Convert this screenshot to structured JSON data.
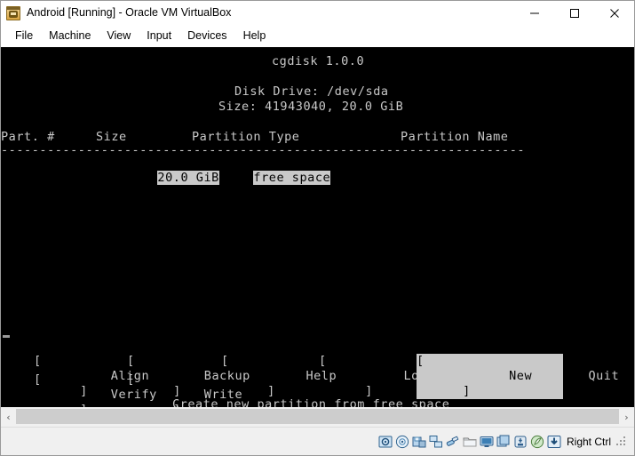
{
  "window": {
    "title": "Android [Running] - Oracle VM VirtualBox",
    "app_icon": "virtualbox-vm-icon",
    "controls": {
      "minimize": "minimize-icon",
      "maximize": "maximize-icon",
      "close": "close-icon"
    }
  },
  "menubar": {
    "items": [
      {
        "label": "File"
      },
      {
        "label": "Machine"
      },
      {
        "label": "View"
      },
      {
        "label": "Input"
      },
      {
        "label": "Devices"
      },
      {
        "label": "Help"
      }
    ]
  },
  "terminal": {
    "program_title": "cgdisk 1.0.0",
    "disk_drive": "Disk Drive: /dev/sda",
    "disk_size": "Size: 41943040, 20.0 GiB",
    "table": {
      "headers": {
        "part_num": "Part. #",
        "size": "Size",
        "partition_type": "Partition Type",
        "partition_name": "Partition Name"
      },
      "separator": "--------------------------------------------------------------------",
      "rows": [
        {
          "part_num": "",
          "size": "20.0 GiB",
          "partition_type": "free space",
          "partition_name": "",
          "selected": true
        }
      ]
    },
    "buttons_row1": [
      {
        "label": "Align",
        "width": 7,
        "selected": false
      },
      {
        "label": "Backup",
        "width": 8,
        "selected": false
      },
      {
        "label": "Help",
        "width": 8,
        "selected": false
      },
      {
        "label": "Load",
        "width": 8,
        "selected": false
      },
      {
        "label": "New",
        "width": 9,
        "selected": true
      },
      {
        "label": "Quit",
        "width": 8,
        "selected": false
      }
    ],
    "buttons_row2": [
      {
        "label": "Verify",
        "width": 8,
        "selected": false
      },
      {
        "label": "Write",
        "width": 8,
        "selected": false
      }
    ],
    "status_hint": "Create new partition from free space",
    "colors": {
      "background": "#000000",
      "foreground": "#c9c9c9",
      "highlight_bg": "#c9c9c9",
      "highlight_fg": "#000000"
    }
  },
  "statusbar": {
    "icons": [
      {
        "name": "hard-disk-icon"
      },
      {
        "name": "optical-disk-icon"
      },
      {
        "name": "floppy-disk-icon"
      },
      {
        "name": "network-icon"
      },
      {
        "name": "usb-icon"
      },
      {
        "name": "shared-folders-icon"
      },
      {
        "name": "display-icon"
      },
      {
        "name": "recording-icon"
      },
      {
        "name": "remote-desktop-icon"
      },
      {
        "name": "mouse-integration-icon"
      },
      {
        "name": "host-key-icon"
      }
    ],
    "host_key": "Right Ctrl"
  },
  "scrollbar": {
    "left_arrow": "chevron-left-icon",
    "right_arrow": "chevron-right-icon"
  }
}
